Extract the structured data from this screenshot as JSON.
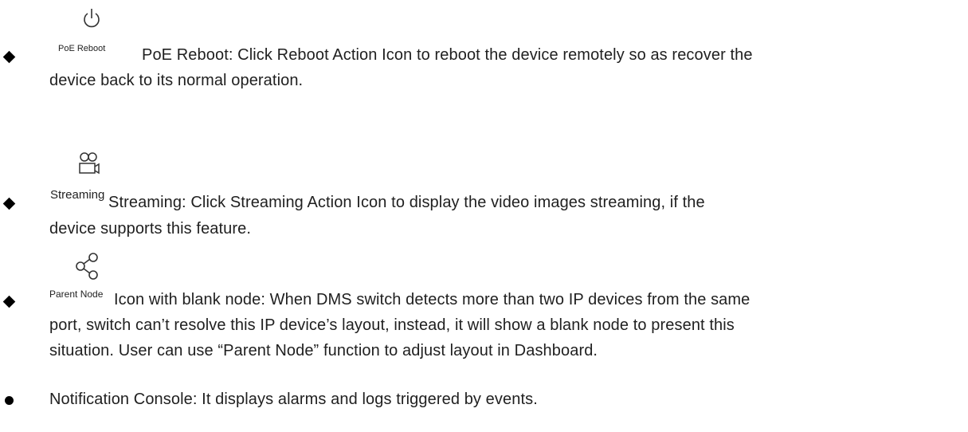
{
  "items": [
    {
      "icon": "power-icon",
      "caption": "PoE Reboot",
      "lines": [
        "PoE Reboot: Click Reboot Action Icon to reboot the device remotely so as recover the",
        "device back to its normal operation."
      ]
    },
    {
      "icon": "camera-icon",
      "caption": "Streaming",
      "lines": [
        "Streaming: Click Streaming Action Icon to display the video images streaming, if the",
        "device supports this feature."
      ]
    },
    {
      "icon": "share-nodes-icon",
      "caption": "Parent Node",
      "lines": [
        "Icon with blank node: When DMS switch detects more than two IP devices from the same",
        "port, switch can’t resolve this IP device’s layout, instead, it will show a blank node to present this",
        "situation. User can use “Parent Node” function to adjust layout in Dashboard."
      ]
    }
  ],
  "notification": {
    "text": "Notification Console: It displays alarms and logs triggered by events."
  }
}
